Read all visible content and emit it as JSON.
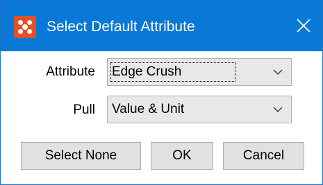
{
  "window": {
    "title": "Select Default Attribute",
    "app_icon": "app-grid-icon",
    "close_icon": "close-icon",
    "titlebar_color": "#0a78d7",
    "app_icon_color": "#e45127"
  },
  "form": {
    "attribute_label": "Attribute",
    "attribute_value": "Edge Crush",
    "pull_label": "Pull",
    "pull_value": "Value & Unit",
    "dropdown_icon": "chevron-down-icon"
  },
  "buttons": {
    "select_none": "Select None",
    "ok": "OK",
    "cancel": "Cancel"
  }
}
